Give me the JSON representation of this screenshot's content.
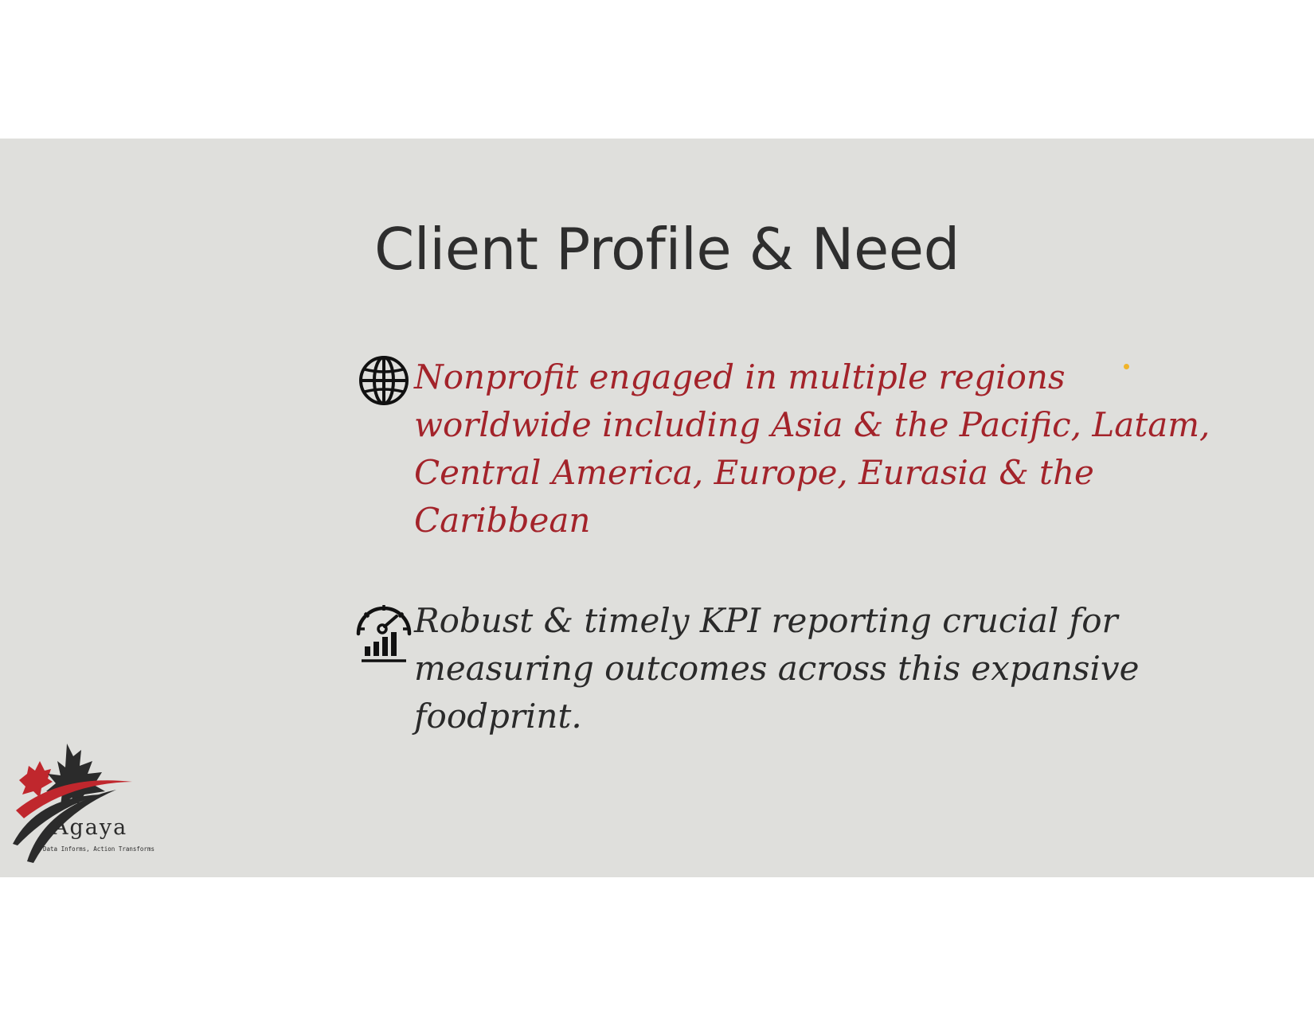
{
  "slide": {
    "title": "Client Profile & Need",
    "bullets": [
      {
        "icon": "globe-icon",
        "text": "Nonprofit engaged in multiple regions worldwide including Asia & the Pacific, Latam, Central America, Europe, Eurasia & the Caribbean",
        "color": "#a3232a"
      },
      {
        "icon": "speedometer-chart-icon",
        "text": "Robust & timely KPI reporting crucial for measuring outcomes across this expansive foodprint.",
        "color": "#2a2a2a"
      }
    ],
    "background_color": "#dfdfdc",
    "accent_dot_color": "#f0b42a"
  },
  "logo": {
    "name": "Agaya",
    "tagline": "Data Informs, Action Transforms",
    "colors": [
      "#c0272d",
      "#2b2b2b"
    ]
  }
}
